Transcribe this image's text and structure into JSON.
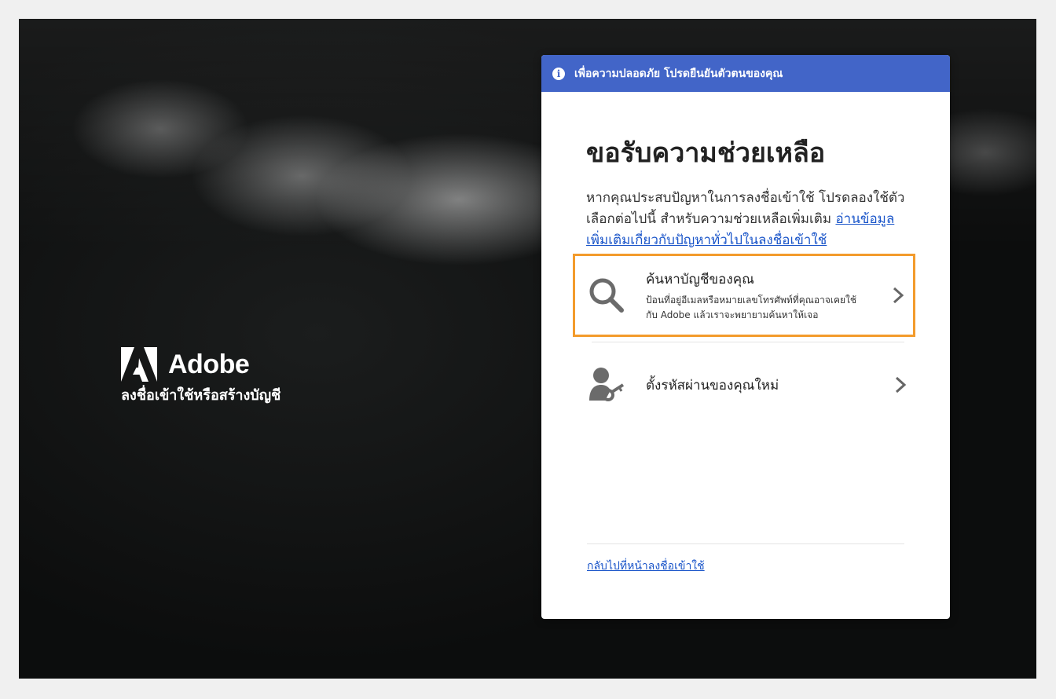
{
  "brand": {
    "name": "Adobe",
    "subtitle": "ลงชื่อเข้าใช้หรือสร้างบัญชี"
  },
  "banner": {
    "text": "เพื่อความปลอดภัย โปรดยืนยันตัวตนของคุณ"
  },
  "card": {
    "title": "ขอรับความช่วยเหลือ",
    "description": "หากคุณประสบปัญหาในการลงชื่อเข้าใช้ โปรดลองใช้ตัวเลือกต่อไปนี้ สำหรับความช่วยเหลือเพิ่มเติม ",
    "help_link": "อ่านข้อมูลเพิ่มเติมเกี่ยวกับปัญหาทั่วไปในลงชื่อเข้าใช้",
    "options": [
      {
        "title": "ค้นหาบัญชีของคุณ",
        "subtitle_line1": "ป้อนที่อยู่อีเมลหรือหมายเลขโทรศัพท์ที่คุณอาจเคยใช้",
        "subtitle_line2": "กับ Adobe แล้วเราจะพยายามค้นหาให้เจอ",
        "icon": "magnifier-icon"
      },
      {
        "title": "ตั้งรหัสผ่านของคุณใหม่",
        "icon": "user-key-icon"
      }
    ],
    "back_link": "กลับไปที่หน้าลงชื่อเข้าใช้"
  },
  "colors": {
    "banner": "#4265c8",
    "highlight": "#f39b2c",
    "link": "#1a55c9"
  }
}
